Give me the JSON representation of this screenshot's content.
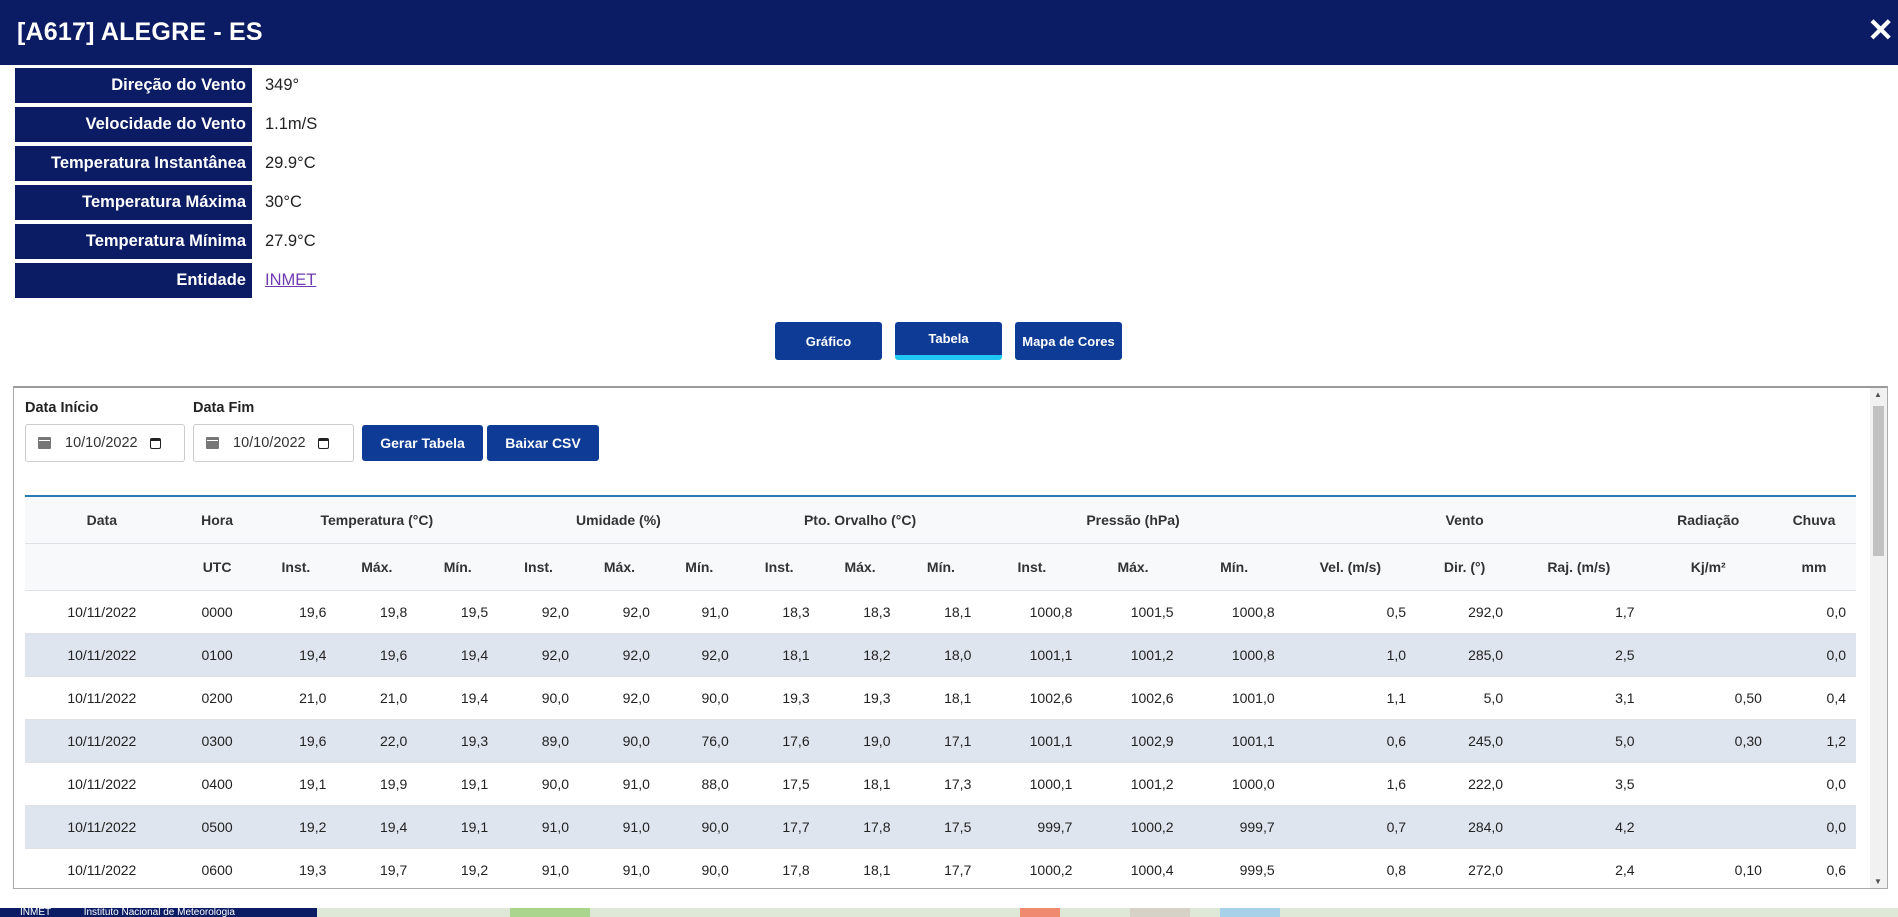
{
  "header": {
    "title": "[A617] ALEGRE - ES",
    "close_glyph": "✕"
  },
  "info": [
    {
      "label": "Direção do Vento",
      "value": "349°"
    },
    {
      "label": "Velocidade do Vento",
      "value": "1.1m/S"
    },
    {
      "label": "Temperatura Instantânea",
      "value": "29.9°C"
    },
    {
      "label": "Temperatura Máxima",
      "value": "30°C"
    },
    {
      "label": "Temperatura Mínima",
      "value": "27.9°C"
    },
    {
      "label": "Entidade",
      "value": "INMET"
    }
  ],
  "tabs": [
    {
      "label": "Gráfico",
      "active": false
    },
    {
      "label": "Tabela",
      "active": true
    },
    {
      "label": "Mapa de Cores",
      "active": false
    }
  ],
  "filters": {
    "start_label": "Data Início",
    "start_value": "10/10/2022",
    "end_label": "Data Fim",
    "end_value": "10/10/2022",
    "generate_button": "Gerar Tabela",
    "csv_button": "Baixar CSV"
  },
  "table": {
    "group_headers": [
      "Data",
      "Hora",
      "Temperatura (°C)",
      "Umidade (%)",
      "Pto. Orvalho (°C)",
      "Pressão (hPa)",
      "Vento",
      "Radiação",
      "Chuva"
    ],
    "sub_headers": [
      "",
      "UTC",
      "Inst.",
      "Máx.",
      "Mín.",
      "Inst.",
      "Máx.",
      "Mín.",
      "Inst.",
      "Máx.",
      "Mín.",
      "Inst.",
      "Máx.",
      "Mín.",
      "Vel. (m/s)",
      "Dir. (°)",
      "Raj. (m/s)",
      "Kj/m²",
      "mm"
    ],
    "rows": [
      [
        "10/11/2022",
        "0000",
        "19,6",
        "19,8",
        "19,5",
        "92,0",
        "92,0",
        "91,0",
        "18,3",
        "18,3",
        "18,1",
        "1000,8",
        "1001,5",
        "1000,8",
        "0,5",
        "292,0",
        "1,7",
        "",
        "0,0"
      ],
      [
        "10/11/2022",
        "0100",
        "19,4",
        "19,6",
        "19,4",
        "92,0",
        "92,0",
        "92,0",
        "18,1",
        "18,2",
        "18,0",
        "1001,1",
        "1001,2",
        "1000,8",
        "1,0",
        "285,0",
        "2,5",
        "",
        "0,0"
      ],
      [
        "10/11/2022",
        "0200",
        "21,0",
        "21,0",
        "19,4",
        "90,0",
        "92,0",
        "90,0",
        "19,3",
        "19,3",
        "18,1",
        "1002,6",
        "1002,6",
        "1001,0",
        "1,1",
        "5,0",
        "3,1",
        "0,50",
        "0,4"
      ],
      [
        "10/11/2022",
        "0300",
        "19,6",
        "22,0",
        "19,3",
        "89,0",
        "90,0",
        "76,0",
        "17,6",
        "19,0",
        "17,1",
        "1001,1",
        "1002,9",
        "1001,1",
        "0,6",
        "245,0",
        "5,0",
        "0,30",
        "1,2"
      ],
      [
        "10/11/2022",
        "0400",
        "19,1",
        "19,9",
        "19,1",
        "90,0",
        "91,0",
        "88,0",
        "17,5",
        "18,1",
        "17,3",
        "1000,1",
        "1001,2",
        "1000,0",
        "1,6",
        "222,0",
        "3,5",
        "",
        "0,0"
      ],
      [
        "10/11/2022",
        "0500",
        "19,2",
        "19,4",
        "19,1",
        "91,0",
        "91,0",
        "90,0",
        "17,7",
        "17,8",
        "17,5",
        "999,7",
        "1000,2",
        "999,7",
        "0,7",
        "284,0",
        "4,2",
        "",
        "0,0"
      ],
      [
        "10/11/2022",
        "0600",
        "19,3",
        "19,7",
        "19,2",
        "91,0",
        "91,0",
        "90,0",
        "17,8",
        "18,1",
        "17,7",
        "1000,2",
        "1000,4",
        "999,5",
        "0,8",
        "272,0",
        "2,4",
        "0,10",
        "0,6"
      ]
    ]
  },
  "footer": {
    "brand": "INMET",
    "institute": "Instituto Nacional de Meteorologia"
  }
}
